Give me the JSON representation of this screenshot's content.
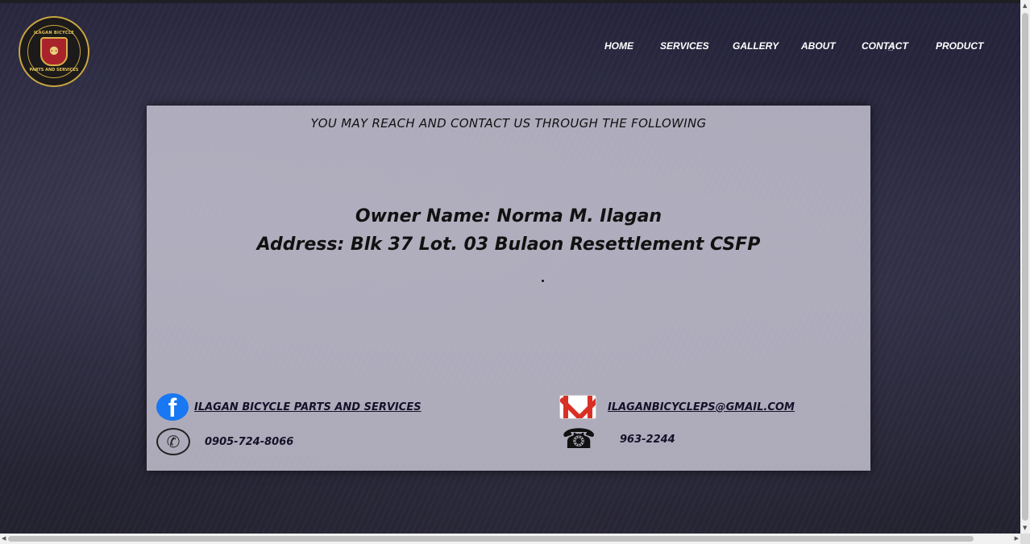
{
  "logo": {
    "top_text": "ILAGAN BICYCLE",
    "bottom_text": "PARTS AND SERVICES",
    "icon": "bicycle-icon"
  },
  "nav": {
    "items": [
      {
        "label": "HOME"
      },
      {
        "label": "SERVICES"
      },
      {
        "label": "GALLERY"
      },
      {
        "label": "ABOUT"
      },
      {
        "label": "CONTACT"
      },
      {
        "label": "PRODUCT"
      }
    ]
  },
  "contact": {
    "heading": "YOU MAY REACH AND CONTACT US THROUGH THE FOLLOWING",
    "owner": "Owner Name: Norma M. Ilagan",
    "address": "Address: Blk 37 Lot. 03 Bulaon Resettlement CSFP",
    "facebook": {
      "label": "ILAGAN BICYCLE PARTS AND SERVICES",
      "icon": "facebook-icon"
    },
    "email": {
      "label": "ILAGANBICYCLEPS@GMAIL.COM",
      "icon": "gmail-icon"
    },
    "mobile": {
      "label": "0905-724-8066",
      "icon": "phone-icon"
    },
    "landline": {
      "label": "963-2244",
      "icon": "telephone-icon"
    }
  },
  "colors": {
    "nav_text": "#ffffff",
    "panel_bg": "#d2d0de",
    "link_text": "#151129",
    "logo_gold": "#c9a640",
    "logo_red": "#a8232a"
  }
}
